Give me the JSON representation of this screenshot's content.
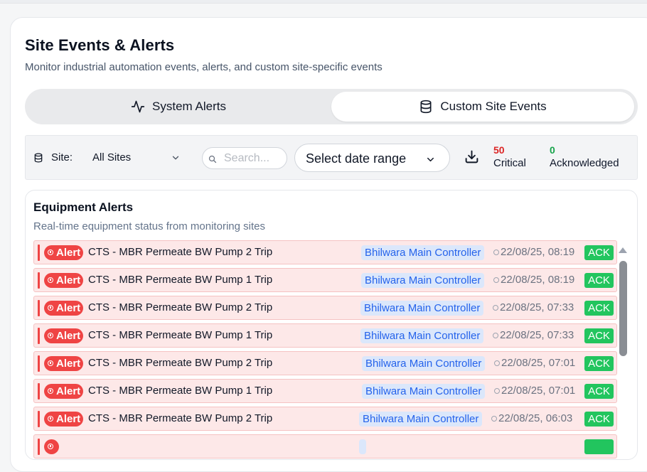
{
  "header": {
    "title": "Site Events & Alerts",
    "subtitle": "Monitor industrial automation events, alerts, and custom site-specific events"
  },
  "tabs": [
    {
      "label": "System Alerts",
      "icon": "activity-icon",
      "active": false
    },
    {
      "label": "Custom Site Events",
      "icon": "database-icon",
      "active": true
    }
  ],
  "filters": {
    "site_label": "Site:",
    "site_value": "All Sites",
    "search_placeholder": "Search...",
    "date_placeholder": "Select date range"
  },
  "stats": {
    "critical_count": "50",
    "critical_label": "Critical",
    "acknowledged_count": "0",
    "acknowledged_label": "Acknowledged"
  },
  "panel": {
    "title": "Equipment Alerts",
    "subtitle": "Real-time equipment status from monitoring sites"
  },
  "alerts": [
    {
      "badge": "Alert",
      "message": "CTS - MBR Permeate BW Pump 2 Trip",
      "controller": "Bhilwara Main Controller",
      "timestamp": "22/08/25, 08:19",
      "action": "ACK"
    },
    {
      "badge": "Alert",
      "message": "CTS - MBR Permeate BW Pump 1 Trip",
      "controller": "Bhilwara Main Controller",
      "timestamp": "22/08/25, 08:19",
      "action": "ACK"
    },
    {
      "badge": "Alert",
      "message": "CTS - MBR Permeate BW Pump 2 Trip",
      "controller": "Bhilwara Main Controller",
      "timestamp": "22/08/25, 07:33",
      "action": "ACK"
    },
    {
      "badge": "Alert",
      "message": "CTS - MBR Permeate BW Pump 1 Trip",
      "controller": "Bhilwara Main Controller",
      "timestamp": "22/08/25, 07:33",
      "action": "ACK"
    },
    {
      "badge": "Alert",
      "message": "CTS - MBR Permeate BW Pump 2 Trip",
      "controller": "Bhilwara Main Controller",
      "timestamp": "22/08/25, 07:01",
      "action": "ACK"
    },
    {
      "badge": "Alert",
      "message": "CTS - MBR Permeate BW Pump 1 Trip",
      "controller": "Bhilwara Main Controller",
      "timestamp": "22/08/25, 07:01",
      "action": "ACK"
    },
    {
      "badge": "Alert",
      "message": "CTS - MBR Permeate BW Pump 2 Trip",
      "controller": "Bhilwara Main Controller",
      "timestamp": "22/08/25, 06:03",
      "action": "ACK"
    },
    {
      "badge": "",
      "message": "",
      "controller": "",
      "timestamp": "",
      "action": ""
    }
  ],
  "colors": {
    "critical": "#dc2626",
    "acknowledged": "#16a34a",
    "alert_badge": "#ef4444",
    "ack_button": "#22c55e",
    "controller_text": "#2563eb"
  }
}
